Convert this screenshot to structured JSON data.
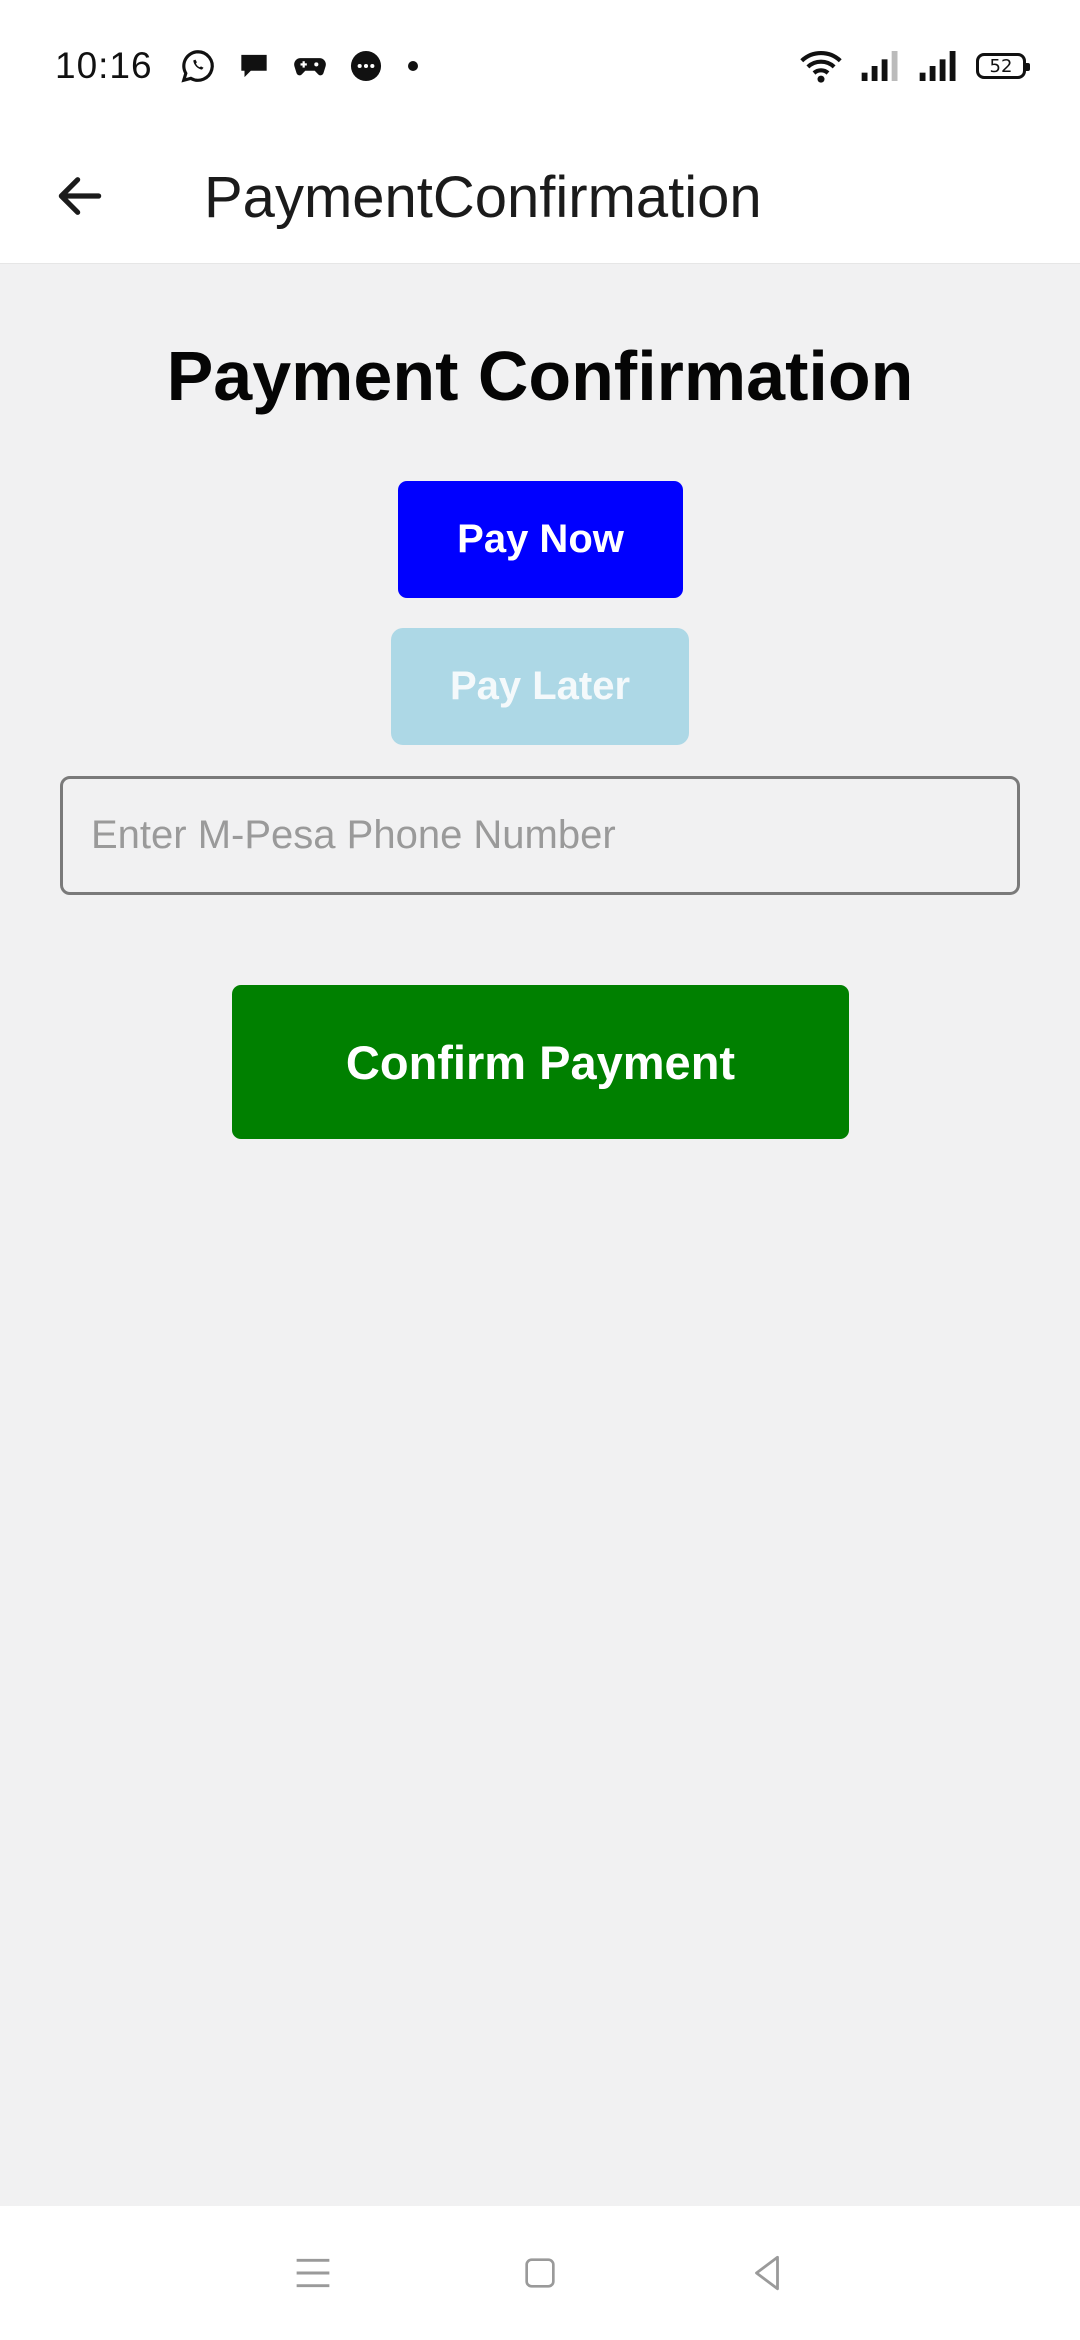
{
  "status_bar": {
    "time": "10:16",
    "battery_level": "52",
    "notification_icons": [
      "whatsapp-icon",
      "chat-bubble-icon",
      "game-controller-icon",
      "messenger-icon",
      "dot-icon"
    ],
    "system_icons": [
      "wifi-icon",
      "signal-icon-sim1",
      "signal-icon-sim2",
      "battery-icon"
    ]
  },
  "app_bar": {
    "title": "PaymentConfirmation",
    "back_icon": "arrow-back-icon"
  },
  "main": {
    "heading": "Payment Confirmation",
    "pay_now_label": "Pay Now",
    "pay_later_label": "Pay Later",
    "phone_input": {
      "value": "",
      "placeholder": "Enter M-Pesa Phone Number"
    },
    "confirm_label": "Confirm Payment"
  },
  "colors": {
    "pay_now": "#0000ff",
    "pay_later": "#add8e6",
    "confirm": "#008000",
    "background": "#f1f1f2"
  },
  "nav_bar": {
    "icons": [
      "menu-icon",
      "home-icon",
      "back-triangle-icon"
    ]
  }
}
